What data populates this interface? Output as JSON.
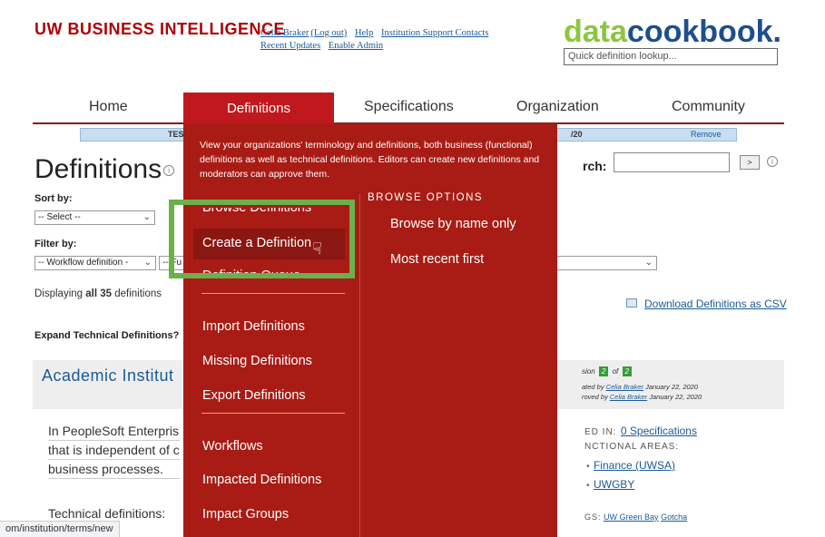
{
  "header": {
    "logo_mark": "UW",
    "logo_text": "BUSINESS INTELLIGENCE",
    "user_link": "Celia Braker",
    "logout": "(Log out)",
    "help": "Help",
    "support": "Institution Support Contacts",
    "recent_updates": "Recent Updates",
    "enable_admin": "Enable Admin",
    "cookbook_part1": "data",
    "cookbook_part2": "cookbook.",
    "quick_lookup_placeholder": "Quick definition lookup..."
  },
  "nav": {
    "home": "Home",
    "definitions": "Definitions",
    "specifications": "Specifications",
    "organization": "Organization",
    "community": "Community"
  },
  "banner": {
    "left_text": "TES",
    "right_text": "/20",
    "remove": "Remove"
  },
  "page": {
    "title": "Definitions",
    "sort_by": "Sort by:",
    "sort_value": "-- Select --",
    "filter_by": "Filter by:",
    "filter_value": "-- Workflow definition -",
    "filter2_value": "-- Fu",
    "displaying_prefix": "Displaying ",
    "displaying_bold": "all 35",
    "displaying_suffix": " definitions",
    "expand": "Expand Technical Definitions?",
    "search_label": "rch:",
    "search_button": ">",
    "download_csv": "Download Definitions as CSV"
  },
  "definition_card": {
    "title": "Academic Institut",
    "version_prefix": "sion",
    "version_current": "2",
    "version_of": "of",
    "version_total": "2",
    "created_prefix": "ated by",
    "created_by": "Celia Braker",
    "created_date": "January 22, 2020",
    "approved_prefix": "roved by",
    "approved_by": "Celia Braker",
    "approved_date": "January 22, 2020",
    "body_line1": "In PeopleSoft Enterpris",
    "body_line2": "that is independent of c",
    "body_line3": "business processes.",
    "technical": "Technical definitions:",
    "used_in_label": "ED IN:",
    "used_in_link": "0 Specifications",
    "functional_label": "NCTIONAL AREAS:",
    "area1": "Finance (UWSA)",
    "area2": "UWGBY",
    "tags_label": "GS:",
    "tag1": "UW Green Bay",
    "tag2": "Gotcha"
  },
  "mega_menu": {
    "description": "View your organizations' terminology and definitions, both business (functional) definitions as well as technical definitions. Editors can create new definitions and moderators can approve them.",
    "left_items": [
      "Browse Definitions",
      "Create a Definition",
      "Definition Queue",
      "Import Definitions",
      "Missing Definitions",
      "Export Definitions",
      "Workflows",
      "Impacted Definitions",
      "Impact Groups"
    ],
    "browse_options_title": "BROWSE OPTIONS",
    "browse_options": [
      "Browse by name only",
      "Most recent first"
    ]
  },
  "status_bar": "om/institution/terms/new",
  "colors": {
    "menu_red": "#a81c15",
    "nav_active": "#c0181d",
    "highlight_green": "#6ab04c",
    "link_blue": "#1a5a96"
  }
}
